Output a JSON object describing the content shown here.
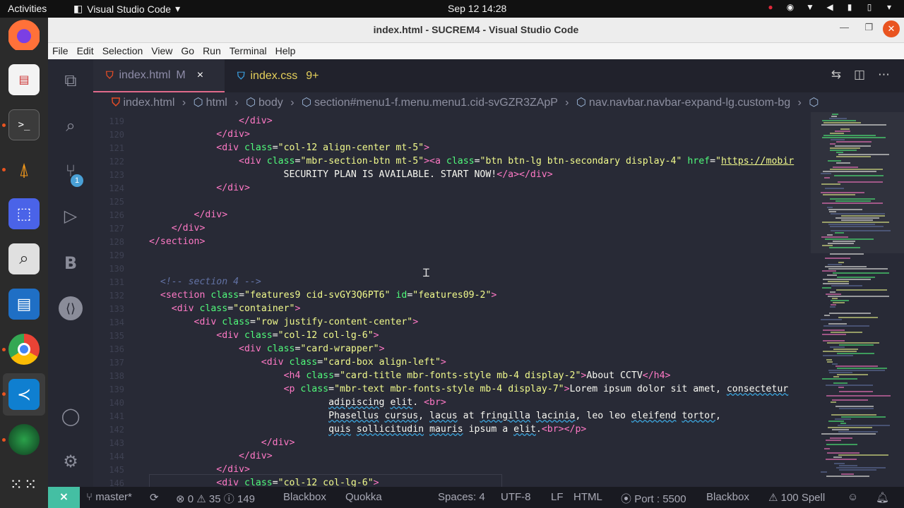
{
  "topbar": {
    "activities": "Activities",
    "app_name": "Visual Studio Code",
    "datetime": "Sep 12  14:28"
  },
  "window": {
    "title": "index.html - SUCREM4 - Visual Studio Code"
  },
  "menu": [
    "File",
    "Edit",
    "Selection",
    "View",
    "Go",
    "Run",
    "Terminal",
    "Help"
  ],
  "activity": {
    "source_control_badge": "1",
    "b_label": "B"
  },
  "tabs": [
    {
      "label": "index.html",
      "status": "M",
      "close": "×",
      "icon": "html5-icon"
    },
    {
      "label": "index.css",
      "status": "9+",
      "icon": "css3-icon"
    }
  ],
  "breadcrumb": [
    "index.html",
    "html",
    "body",
    "section#menu1-f.menu.menu1.cid-svGZR3ZApP",
    "nav.navbar.navbar-expand-lg.custom-bg"
  ],
  "editor": {
    "line_numbers": [
      "119",
      "120",
      "121",
      "122",
      "123",
      "124",
      "125",
      "126",
      "127",
      "128",
      "129",
      "130",
      "131",
      "132",
      "133",
      "134",
      "135",
      "136",
      "137",
      "138",
      "139",
      "140",
      "141",
      "142",
      "143",
      "144",
      "145",
      "146"
    ]
  },
  "status": {
    "branch": "master*",
    "errors": "0",
    "warnings": "35",
    "info": "149",
    "blackbox_left": "Blackbox",
    "quokka": "Quokka",
    "spaces": "Spaces: 4",
    "encoding": "UTF-8",
    "eol": "LF",
    "language": "HTML",
    "port": "Port : 5500",
    "blackbox_right": "Blackbox",
    "spell": "100 Spell"
  },
  "colors": {
    "editor_bg": "#282a36",
    "tag": "#ff79c6",
    "attr": "#50fa7b",
    "string": "#f1fa8c",
    "comment": "#6272a4",
    "remote_indicator": "#44bfa3"
  }
}
